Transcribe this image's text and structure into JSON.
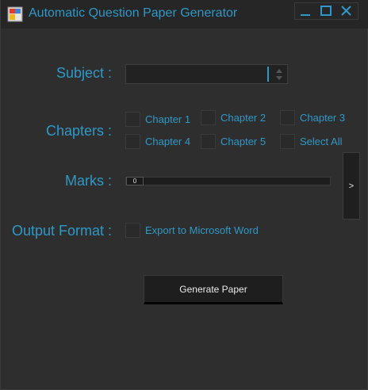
{
  "window": {
    "title": "Automatic Question Paper Generator",
    "accent_color": "#2f98c6",
    "background_color": "#2e2e2e",
    "icons": [
      "app-icon",
      "minimize-icon",
      "maximize-icon",
      "close-icon"
    ]
  },
  "form": {
    "subject_label": "Subject :",
    "subject_value": "",
    "chapters_label": "Chapters :",
    "chapters": [
      {
        "label": "Chapter 1",
        "checked": false
      },
      {
        "label": "Chapter 2",
        "checked": false
      },
      {
        "label": "Chapter 3",
        "checked": false
      },
      {
        "label": "Chapter 4",
        "checked": false
      },
      {
        "label": "Chapter 5",
        "checked": false
      },
      {
        "label": "Select All",
        "checked": false
      }
    ],
    "marks_label": "Marks :",
    "marks_value": "0",
    "next_button_label": ">",
    "output_label": "Output Format :",
    "export_word_label": "Export to Microsoft Word",
    "export_word_checked": false,
    "generate_button_label": "Generate Paper"
  }
}
